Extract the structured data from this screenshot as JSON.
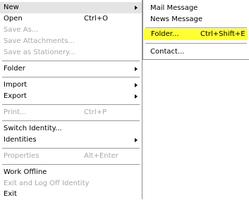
{
  "main_menu": {
    "new": "New",
    "open": "Open",
    "open_shortcut": "Ctrl+O",
    "save_as": "Save As...",
    "save_attachments": "Save Attachments...",
    "save_as_stationery": "Save as Stationery...",
    "folder": "Folder",
    "import": "Import",
    "export": "Export",
    "print": "Print...",
    "print_shortcut": "Ctrl+P",
    "switch_identity": "Switch Identity...",
    "identities": "Identities",
    "properties": "Properties",
    "properties_shortcut": "Alt+Enter",
    "work_offline": "Work Offline",
    "exit_log_off": "Exit and Log Off Identity",
    "exit": "Exit"
  },
  "new_submenu": {
    "mail_message": "Mail Message",
    "news_message": "News Message",
    "folder": "Folder...",
    "folder_shortcut": "Ctrl+Shift+E",
    "contact": "Contact..."
  },
  "colors": {
    "selected_bg": "#e4e4e4",
    "highlight": "#ffff33",
    "disabled_text": "#a8a8a8"
  }
}
